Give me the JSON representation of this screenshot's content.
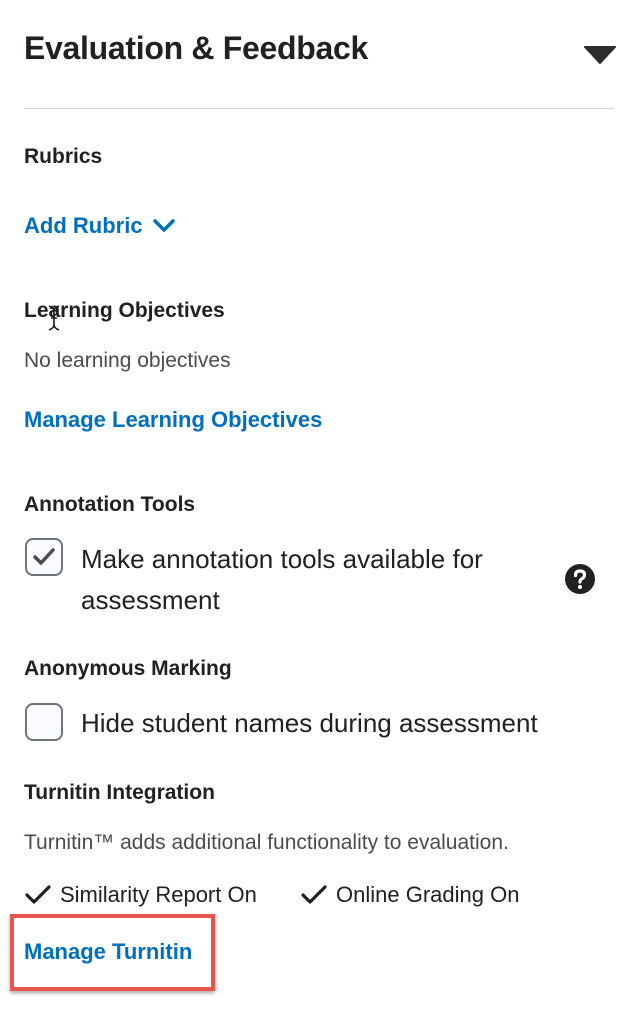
{
  "panel": {
    "title": "Evaluation & Feedback",
    "collapse_icon": "triangle-down-icon"
  },
  "rubrics": {
    "label": "Rubrics",
    "add_link": "Add Rubric",
    "add_icon": "chevron-down-icon"
  },
  "learning_objectives": {
    "label": "Learning Objectives",
    "empty_text": "No learning objectives",
    "manage_link": "Manage Learning Objectives"
  },
  "annotation_tools": {
    "label": "Annotation Tools",
    "checkbox_label_line1": "Make annotation tools available for",
    "checkbox_label_line2": "assessment",
    "checked": true,
    "help_icon": "question-circle-icon"
  },
  "anonymous_marking": {
    "label": "Anonymous Marking",
    "checkbox_label": "Hide student names during assessment",
    "checked": false
  },
  "turnitin": {
    "label": "Turnitin Integration",
    "description": "Turnitin™ adds additional functionality to evaluation.",
    "status_items": [
      "Similarity Report On",
      "Online Grading On"
    ],
    "manage_link": "Manage Turnitin"
  },
  "colors": {
    "link": "#006fbf",
    "highlight": "#e8554e",
    "divider": "#cfd3e0"
  }
}
